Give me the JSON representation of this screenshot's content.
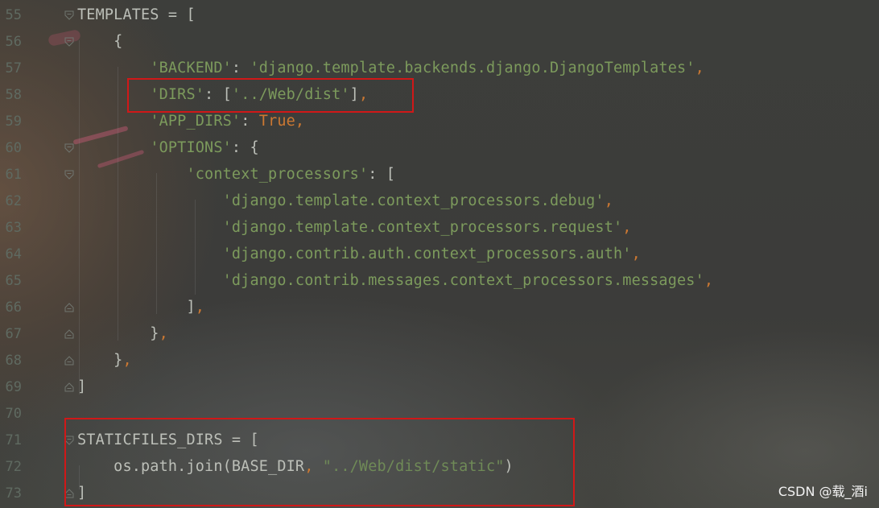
{
  "editor": {
    "lines": [
      {
        "num": "55",
        "segments": [
          {
            "cls": "plain",
            "text": "TEMPLATES = ["
          }
        ]
      },
      {
        "num": "56",
        "segments": [
          {
            "cls": "plain",
            "text": "    {"
          }
        ]
      },
      {
        "num": "57",
        "segments": [
          {
            "cls": "plain",
            "text": "        "
          },
          {
            "cls": "str",
            "text": "'BACKEND'"
          },
          {
            "cls": "plain",
            "text": ": "
          },
          {
            "cls": "str",
            "text": "'django.template.backends.django.DjangoTemplates'"
          },
          {
            "cls": "kw",
            "text": ","
          }
        ]
      },
      {
        "num": "58",
        "segments": [
          {
            "cls": "plain",
            "text": "        "
          },
          {
            "cls": "str",
            "text": "'DIRS'"
          },
          {
            "cls": "plain",
            "text": ": ["
          },
          {
            "cls": "str",
            "text": "'../Web/dist'"
          },
          {
            "cls": "plain",
            "text": "]"
          },
          {
            "cls": "kw",
            "text": ","
          }
        ]
      },
      {
        "num": "59",
        "segments": [
          {
            "cls": "plain",
            "text": "        "
          },
          {
            "cls": "str",
            "text": "'APP_DIRS'"
          },
          {
            "cls": "plain",
            "text": ": "
          },
          {
            "cls": "kw",
            "text": "True,"
          }
        ]
      },
      {
        "num": "60",
        "segments": [
          {
            "cls": "plain",
            "text": "        "
          },
          {
            "cls": "str",
            "text": "'OPTIONS'"
          },
          {
            "cls": "plain",
            "text": ": {"
          }
        ]
      },
      {
        "num": "61",
        "segments": [
          {
            "cls": "plain",
            "text": "            "
          },
          {
            "cls": "str",
            "text": "'context_processors'"
          },
          {
            "cls": "plain",
            "text": ": ["
          }
        ]
      },
      {
        "num": "62",
        "segments": [
          {
            "cls": "plain",
            "text": "                "
          },
          {
            "cls": "str",
            "text": "'django.template.context_processors.debug'"
          },
          {
            "cls": "kw",
            "text": ","
          }
        ]
      },
      {
        "num": "63",
        "segments": [
          {
            "cls": "plain",
            "text": "                "
          },
          {
            "cls": "str",
            "text": "'django.template.context_processors.request'"
          },
          {
            "cls": "kw",
            "text": ","
          }
        ]
      },
      {
        "num": "64",
        "segments": [
          {
            "cls": "plain",
            "text": "                "
          },
          {
            "cls": "str",
            "text": "'django.contrib.auth.context_processors.auth'"
          },
          {
            "cls": "kw",
            "text": ","
          }
        ]
      },
      {
        "num": "65",
        "segments": [
          {
            "cls": "plain",
            "text": "                "
          },
          {
            "cls": "str",
            "text": "'django.contrib.messages.context_processors.messages'"
          },
          {
            "cls": "kw",
            "text": ","
          }
        ]
      },
      {
        "num": "66",
        "segments": [
          {
            "cls": "plain",
            "text": "            ]"
          },
          {
            "cls": "kw",
            "text": ","
          }
        ]
      },
      {
        "num": "67",
        "segments": [
          {
            "cls": "plain",
            "text": "        }"
          },
          {
            "cls": "kw",
            "text": ","
          }
        ]
      },
      {
        "num": "68",
        "segments": [
          {
            "cls": "plain",
            "text": "    }"
          },
          {
            "cls": "kw",
            "text": ","
          }
        ]
      },
      {
        "num": "69",
        "segments": [
          {
            "cls": "plain",
            "text": "]"
          }
        ]
      },
      {
        "num": "70",
        "segments": []
      },
      {
        "num": "71",
        "segments": [
          {
            "cls": "plain",
            "text": "STATICFILES_DIRS = ["
          }
        ]
      },
      {
        "num": "72",
        "segments": [
          {
            "cls": "plain",
            "text": "    os.path.join(BASE_DIR"
          },
          {
            "cls": "kw",
            "text": ", "
          },
          {
            "cls": "strq",
            "text": "\"../Web/dist/static\""
          },
          {
            "cls": "plain",
            "text": ")"
          }
        ]
      },
      {
        "num": "73",
        "segments": [
          {
            "cls": "plain",
            "text": "]"
          }
        ]
      }
    ]
  },
  "watermark": "CSDN @载_酒i",
  "colors": {
    "string": "#7c9a5c",
    "keyword": "#cc7832",
    "plain": "#bcbfb8",
    "line_number": "#5f6a61",
    "highlight": "#d01818"
  }
}
